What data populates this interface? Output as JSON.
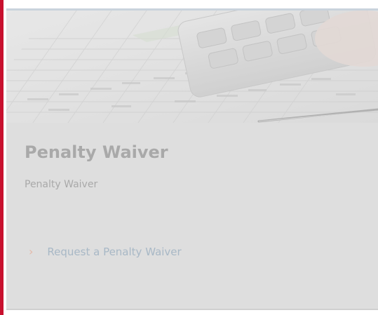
{
  "card": {
    "title": "Penalty Waiver",
    "subtitle": "Penalty Waiver",
    "link_label": "Request a Penalty Waiver",
    "link_icon": "chevron-right-icon",
    "hero_image": "spreadsheet-calculator-photo"
  },
  "colors": {
    "accent": "#c8102e",
    "card_background": "#dedede",
    "title_text": "#a9a9a9",
    "link_text": "#a8b8c6",
    "chevron": "#e4b8a8"
  }
}
